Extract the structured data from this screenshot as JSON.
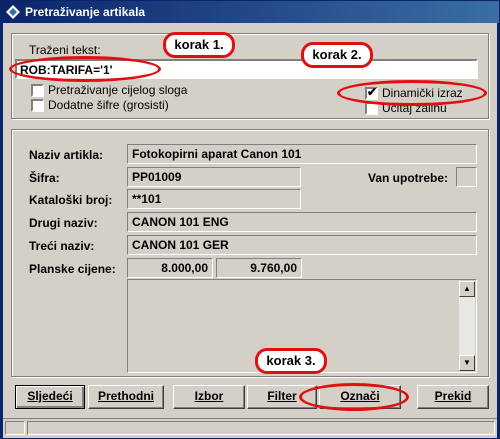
{
  "window": {
    "title": "Pretraživanje artikala"
  },
  "search": {
    "label": "Traženi tekst:",
    "value": "ROB:TARIFA='1'",
    "opt_full_record": "Pretraživanje cijelog sloga",
    "opt_extra_codes": "Dodatne šifre (grosisti)",
    "opt_dynamic": "Dinamički izraz",
    "opt_dynamic_checked": true,
    "opt_load_stock": "Učitaj zalihu"
  },
  "detail": {
    "name_label": "Naziv artikla:",
    "name_value": "Fotokopirni aparat Canon 101",
    "code_label": "Šifra:",
    "code_value": "PP01009",
    "out_of_use_label": "Van upotrebe:",
    "catalog_label": "Kataloški broj:",
    "catalog_value": "**101",
    "name2_label": "Drugi naziv:",
    "name2_value": "CANON 101 ENG",
    "name3_label": "Treći naziv:",
    "name3_value": "CANON 101 GER",
    "plan_label": "Planske cijene:",
    "plan_price1": "8.000,00",
    "plan_price2": "9.760,00"
  },
  "buttons": {
    "next": "Sljedeći",
    "prev": "Prethodni",
    "select": "Izbor",
    "filter": "Filter",
    "mark": "Označi",
    "cancel": "Prekid"
  },
  "annotations": {
    "step1": "korak 1.",
    "step2": "korak 2.",
    "step3": "korak 3."
  },
  "colors": {
    "accent": "#e01010",
    "title_bar": "#0a246a",
    "face": "#d4d0c8"
  }
}
